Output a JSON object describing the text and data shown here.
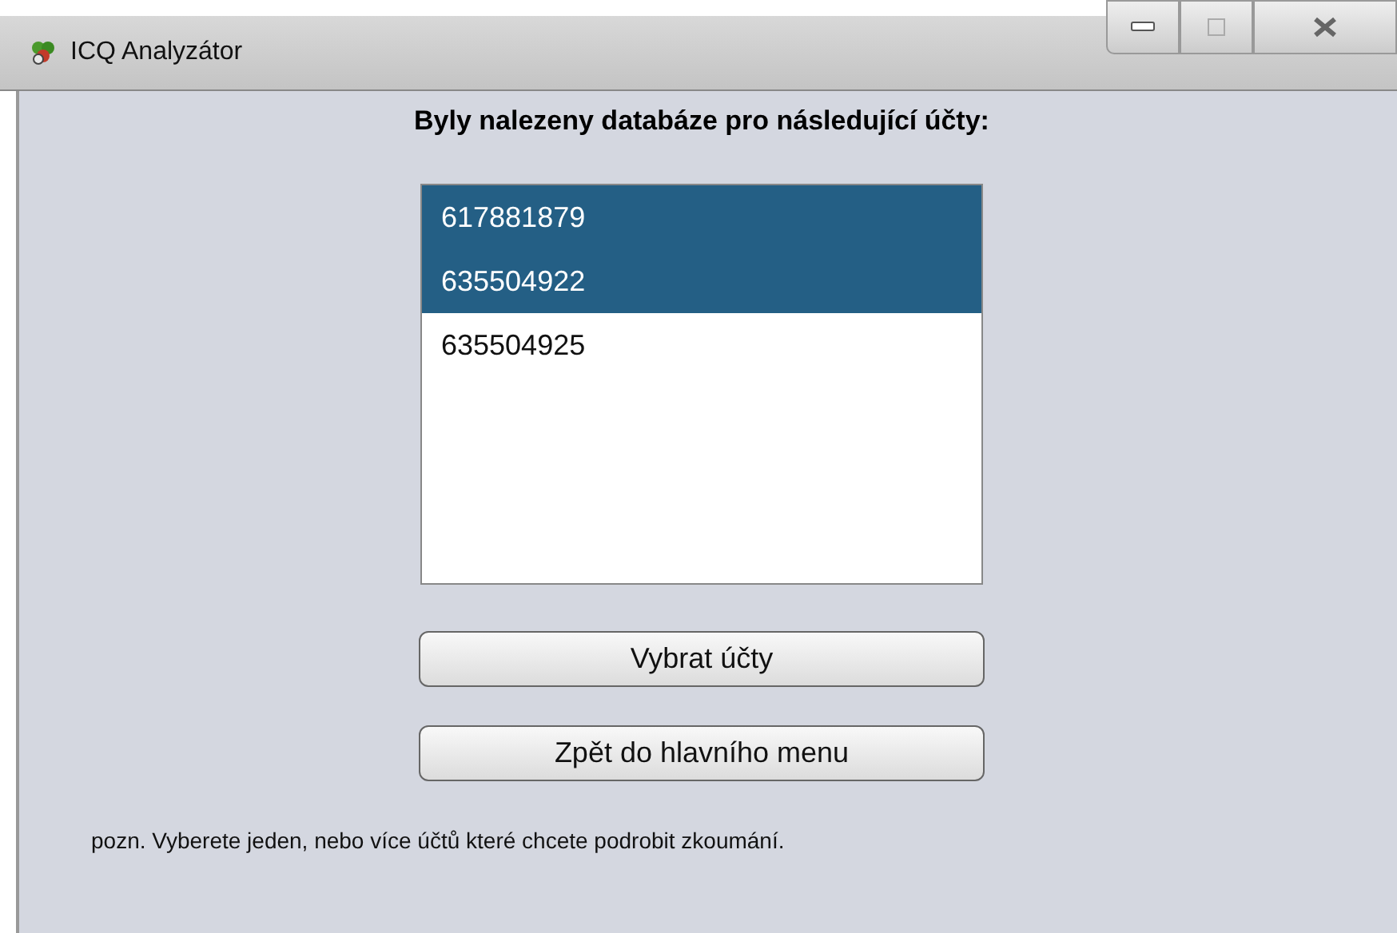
{
  "window": {
    "title": "ICQ Analyzátor"
  },
  "heading": "Byly nalezeny databáze pro následující účty:",
  "accounts": [
    {
      "label": "617881879",
      "selected": true
    },
    {
      "label": "635504922",
      "selected": true
    },
    {
      "label": "635504925",
      "selected": false
    }
  ],
  "buttons": [
    "Vybrat účty",
    "Zpět do hlavního menu"
  ],
  "note": "pozn. Vyberete jeden, nebo více účtů které chcete podrobit zkoumání."
}
